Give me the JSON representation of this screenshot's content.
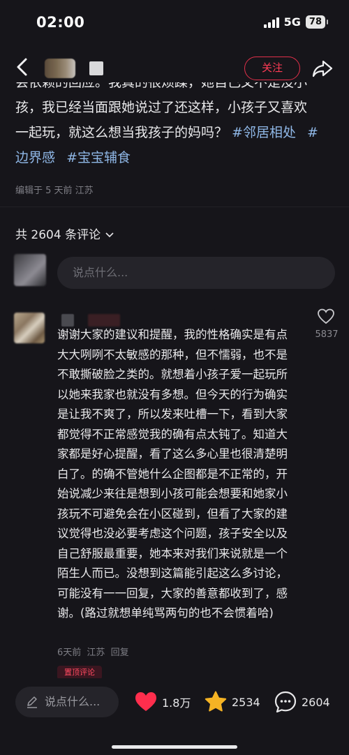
{
  "status_bar": {
    "time": "02:00",
    "network": "5G",
    "battery": "78"
  },
  "nav": {
    "follow_label": "关注"
  },
  "post": {
    "cut_line": "会依赖的回应。我真的很烦躁，她自己又不是没小",
    "line1": "孩，我已经当面跟她说过了还这样，小孩子又喜欢",
    "line2_text": "一起玩，就这么想当我孩子的妈吗？",
    "tag1": "#邻居相处",
    "tag2_a": "#",
    "tag2_b": "边界感",
    "tag3": "#宝宝辅食",
    "meta": "编辑于 5 天前 江苏"
  },
  "comments_header": {
    "count_label": "共 2604 条评论"
  },
  "comment_input": {
    "placeholder": "说点什么..."
  },
  "comment": {
    "likes": "5837",
    "text": "谢谢大家的建议和提醒，我的性格确实是有点大大咧咧不太敏感的那种，但不懦弱，也不是不敢撕破脸之类的。就想着小孩子爱一起玩所以她来我家也就没有多想。但今天的行为确实是让我不爽了，所以发来吐槽一下，看到大家都觉得不正常感觉我的确有点太钝了。知道大家都是好心提醒，看了这么多心里也很清楚明白了。的确不管她什么企图都是不正常的，开始说减少来往是想到小孩可能会想要和她家小孩玩不可避免会在小区碰到，但看了大家的建议觉得也没必要考虑这个问题，孩子安全以及自己舒服最重要，她本来对我们来说就是一个陌生人而已。没想到这篇能引起这么多讨论，可能没有一一回复，大家的善意都收到了，感谢。(路过就想单纯骂两句的也不会惯着哈)",
    "time": "6天前",
    "location": "江苏",
    "reply_label": "回复",
    "pin_label": "置顶评论"
  },
  "bottom_bar": {
    "placeholder": "说点什么...",
    "likes": "1.8万",
    "stars": "2534",
    "comments": "2604"
  },
  "colors": {
    "accent": "#ff2e4d",
    "star": "#f5b324",
    "tag": "#8fb7e6"
  }
}
